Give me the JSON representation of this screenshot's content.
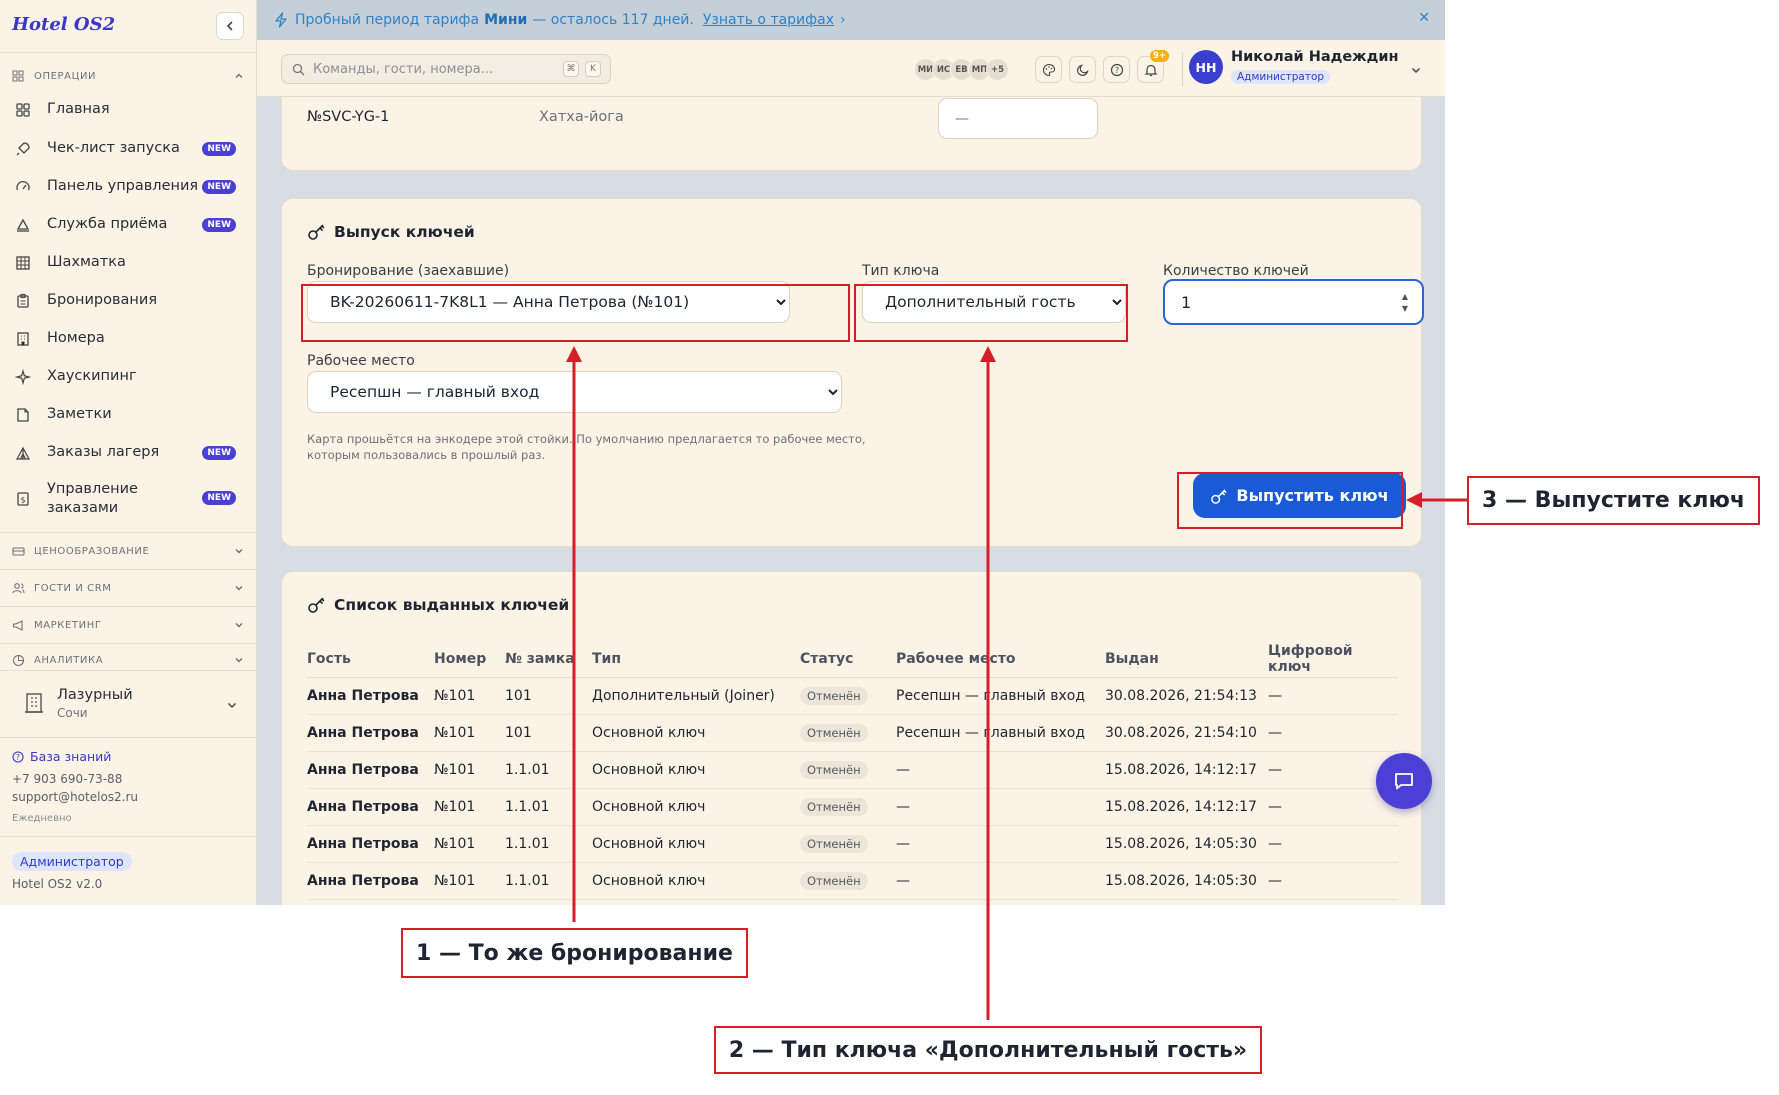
{
  "app": {
    "logo": "Hotel OS2",
    "version": "Hotel OS2 v2.0"
  },
  "sidebar": {
    "section_operations": "ОПЕРАЦИИ",
    "items": [
      {
        "label": "Главная",
        "icon": "grid-icon",
        "badge": ""
      },
      {
        "label": "Чек-лист запуска",
        "icon": "rocket-icon",
        "badge": "NEW"
      },
      {
        "label": "Панель управления",
        "icon": "gauge-icon",
        "badge": "NEW"
      },
      {
        "label": "Служба приёма",
        "icon": "bell-icon",
        "badge": "NEW"
      },
      {
        "label": "Шахматка",
        "icon": "table-icon",
        "badge": ""
      },
      {
        "label": "Бронирования",
        "icon": "clipboard-icon",
        "badge": ""
      },
      {
        "label": "Номера",
        "icon": "building-icon",
        "badge": ""
      },
      {
        "label": "Хаускипинг",
        "icon": "sparkle-icon",
        "badge": ""
      },
      {
        "label": "Заметки",
        "icon": "note-icon",
        "badge": ""
      },
      {
        "label": "Заказы лагеря",
        "icon": "tent-icon",
        "badge": "NEW"
      },
      {
        "label": "Управление заказами",
        "icon": "receipt-icon",
        "badge": "NEW"
      }
    ],
    "sections": [
      {
        "label": "ЦЕНООБРАЗОВАНИЕ",
        "icon": "wallet-icon"
      },
      {
        "label": "ГОСТИ И CRM",
        "icon": "users-icon"
      },
      {
        "label": "МАРКЕТИНГ",
        "icon": "megaphone-icon"
      },
      {
        "label": "АНАЛИТИКА",
        "icon": "chart-icon"
      }
    ],
    "hotel_name": "Лазурный",
    "hotel_city": "Сочи",
    "knowledge_base": "База знаний",
    "phone": "+7 903 690-73-88",
    "email": "support@hotelos2.ru",
    "schedule": "Ежедневно",
    "role": "Администратор"
  },
  "banner": {
    "text_before": "Пробный период тарифа",
    "plan": "Мини",
    "text_after": "— осталось 117 дней.",
    "link": "Узнать о тарифах",
    "link_arrow": "›",
    "close": "✕"
  },
  "header": {
    "search_placeholder": "Команды, гости, номера...",
    "kbd_1": "⌘",
    "kbd_2": "K",
    "avatars": [
      "МИ",
      "ИС",
      "ЕВ",
      "МП",
      "+5"
    ],
    "notification_count": "9+",
    "user_initials": "НН",
    "user_name": "Николай Надеждин",
    "user_role": "Администратор"
  },
  "service_row": {
    "code": "№SVC-YG-1",
    "name": "Хатха-йога",
    "input_placeholder": "—"
  },
  "issue_card": {
    "title": "Выпуск ключей",
    "booking_label": "Бронирование (заехавшие)",
    "booking_value": "BK-20260611-7K8L1 — Анна Петрова (№101)",
    "key_type_label": "Тип ключа",
    "key_type_value": "Дополнительный гость",
    "qty_label": "Количество ключей",
    "qty_value": "1",
    "workplace_label": "Рабочее место",
    "workplace_value": "Ресепшн — главный вход",
    "hint": "Карта прошьётся на энкодере этой стойки. По умолчанию предлагается то рабочее место, которым пользовались в прошлый раз.",
    "button": "Выпустить ключ"
  },
  "keys_card": {
    "title": "Список выданных ключей",
    "columns": [
      "Гость",
      "Номер",
      "№ замка",
      "Тип",
      "Статус",
      "Рабочее место",
      "Выдан",
      "Цифровой ключ"
    ],
    "rows": [
      [
        "Анна Петрова",
        "№101",
        "101",
        "Дополнительный (Joiner)",
        "Отменён",
        "Ресепшн — главный вход",
        "30.08.2026, 21:54:13",
        "—"
      ],
      [
        "Анна Петрова",
        "№101",
        "101",
        "Основной ключ",
        "Отменён",
        "Ресепшн — главный вход",
        "30.08.2026, 21:54:10",
        "—"
      ],
      [
        "Анна Петрова",
        "№101",
        "1.1.01",
        "Основной ключ",
        "Отменён",
        "—",
        "15.08.2026, 14:12:17",
        "—"
      ],
      [
        "Анна Петрова",
        "№101",
        "1.1.01",
        "Основной ключ",
        "Отменён",
        "—",
        "15.08.2026, 14:12:17",
        "—"
      ],
      [
        "Анна Петрова",
        "№101",
        "1.1.01",
        "Основной ключ",
        "Отменён",
        "—",
        "15.08.2026, 14:05:30",
        "—"
      ],
      [
        "Анна Петрова",
        "№101",
        "1.1.01",
        "Основной ключ",
        "Отменён",
        "—",
        "15.08.2026, 14:05:30",
        "—"
      ]
    ]
  },
  "annotations": {
    "step1": "1 — То же бронирование",
    "step2": "2 — Тип ключа «Дополнительный гость»",
    "step3": "3 — Выпустите ключ",
    "color": "#d71e28"
  },
  "colors": {
    "accent": "#3a36c8",
    "primary_button": "#1a5ad6",
    "banner_bg": "#c4cfd7",
    "surface": "#fbf3e6"
  }
}
